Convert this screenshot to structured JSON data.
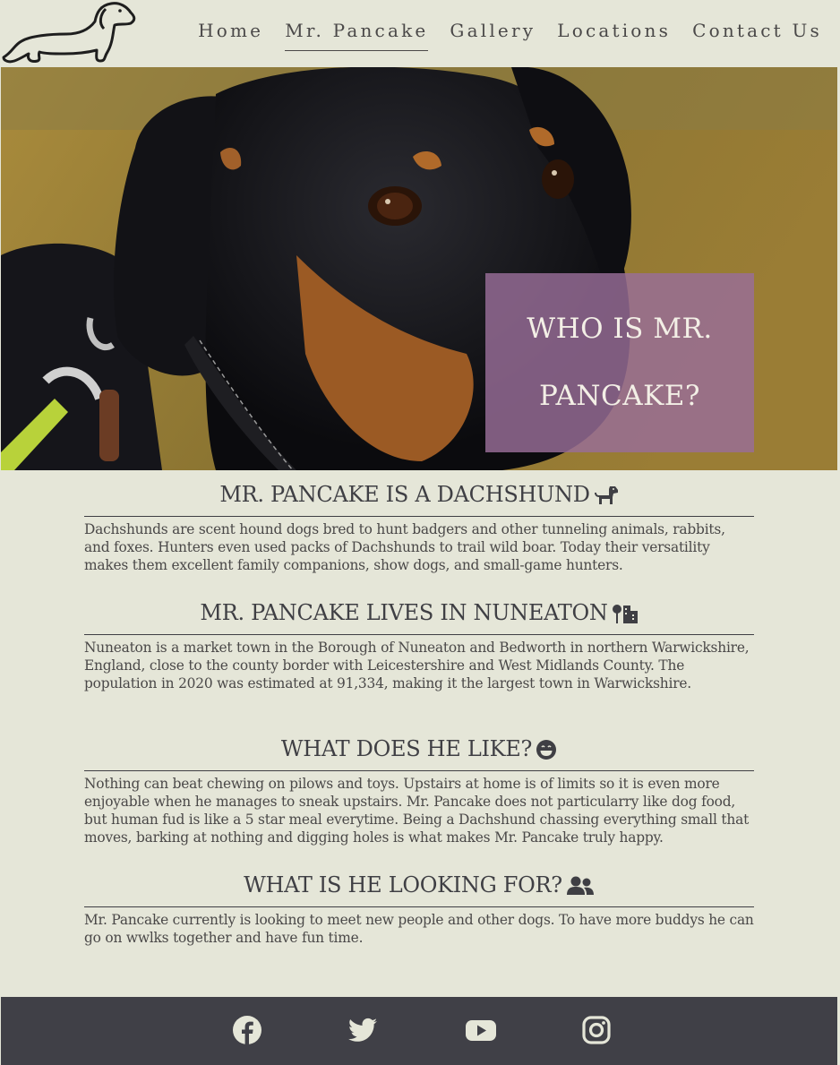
{
  "nav": {
    "items": [
      {
        "label": "Home",
        "active": false
      },
      {
        "label": "Mr. Pancake",
        "active": true
      },
      {
        "label": "Gallery",
        "active": false
      },
      {
        "label": "Locations",
        "active": false
      },
      {
        "label": "Contact Us",
        "active": false
      }
    ]
  },
  "hero": {
    "heading_line1": "WHO IS MR.",
    "heading_line2": "PANCAKE?"
  },
  "sections": [
    {
      "title": "MR. PANCAKE IS A DACHSHUND",
      "icon": "dog-icon",
      "text": "Dachshunds are scent hound dogs bred to hunt badgers and other tunneling animals, rabbits, and foxes. Hunters even used packs of Dachshunds to trail wild boar. Today their versatility makes them excellent family companions, show dogs, and small-game hunters."
    },
    {
      "title": "MR. PANCAKE LIVES IN NUNEATON",
      "icon": "city-icon",
      "text": "Nuneaton is a market town in the Borough of Nuneaton and Bedworth in northern Warwickshire, England, close to the county border with Leicestershire and West Midlands County. The population in 2020 was estimated at 91,334, making it the largest town in Warwickshire."
    },
    {
      "title": "WHAT DOES HE LIKE?",
      "icon": "grin-icon",
      "text": "Nothing can beat chewing on pilows and toys. Upstairs at home is of limits so it is even more enjoyable when he manages to sneak upstairs. Mr. Pancake does not particularry like dog food, but human fud is like a 5 star meal everytime. Being a Dachshund chassing everything small that moves, barking at nothing and digging holes is what makes Mr. Pancake truly happy."
    },
    {
      "title": "WHAT IS HE LOOKING FOR?",
      "icon": "users-icon",
      "text": "Mr. Pancake currently is looking to meet new people and other dogs. To have more buddys he can go on wwlks together and have fun time."
    }
  ],
  "footer": {
    "icons": [
      "facebook-icon",
      "twitter-icon",
      "youtube-icon",
      "instagram-icon"
    ]
  },
  "colors": {
    "background": "#e5e6d8",
    "text": "#4a4848",
    "hero_box": "#986e98",
    "footer": "#404047"
  }
}
